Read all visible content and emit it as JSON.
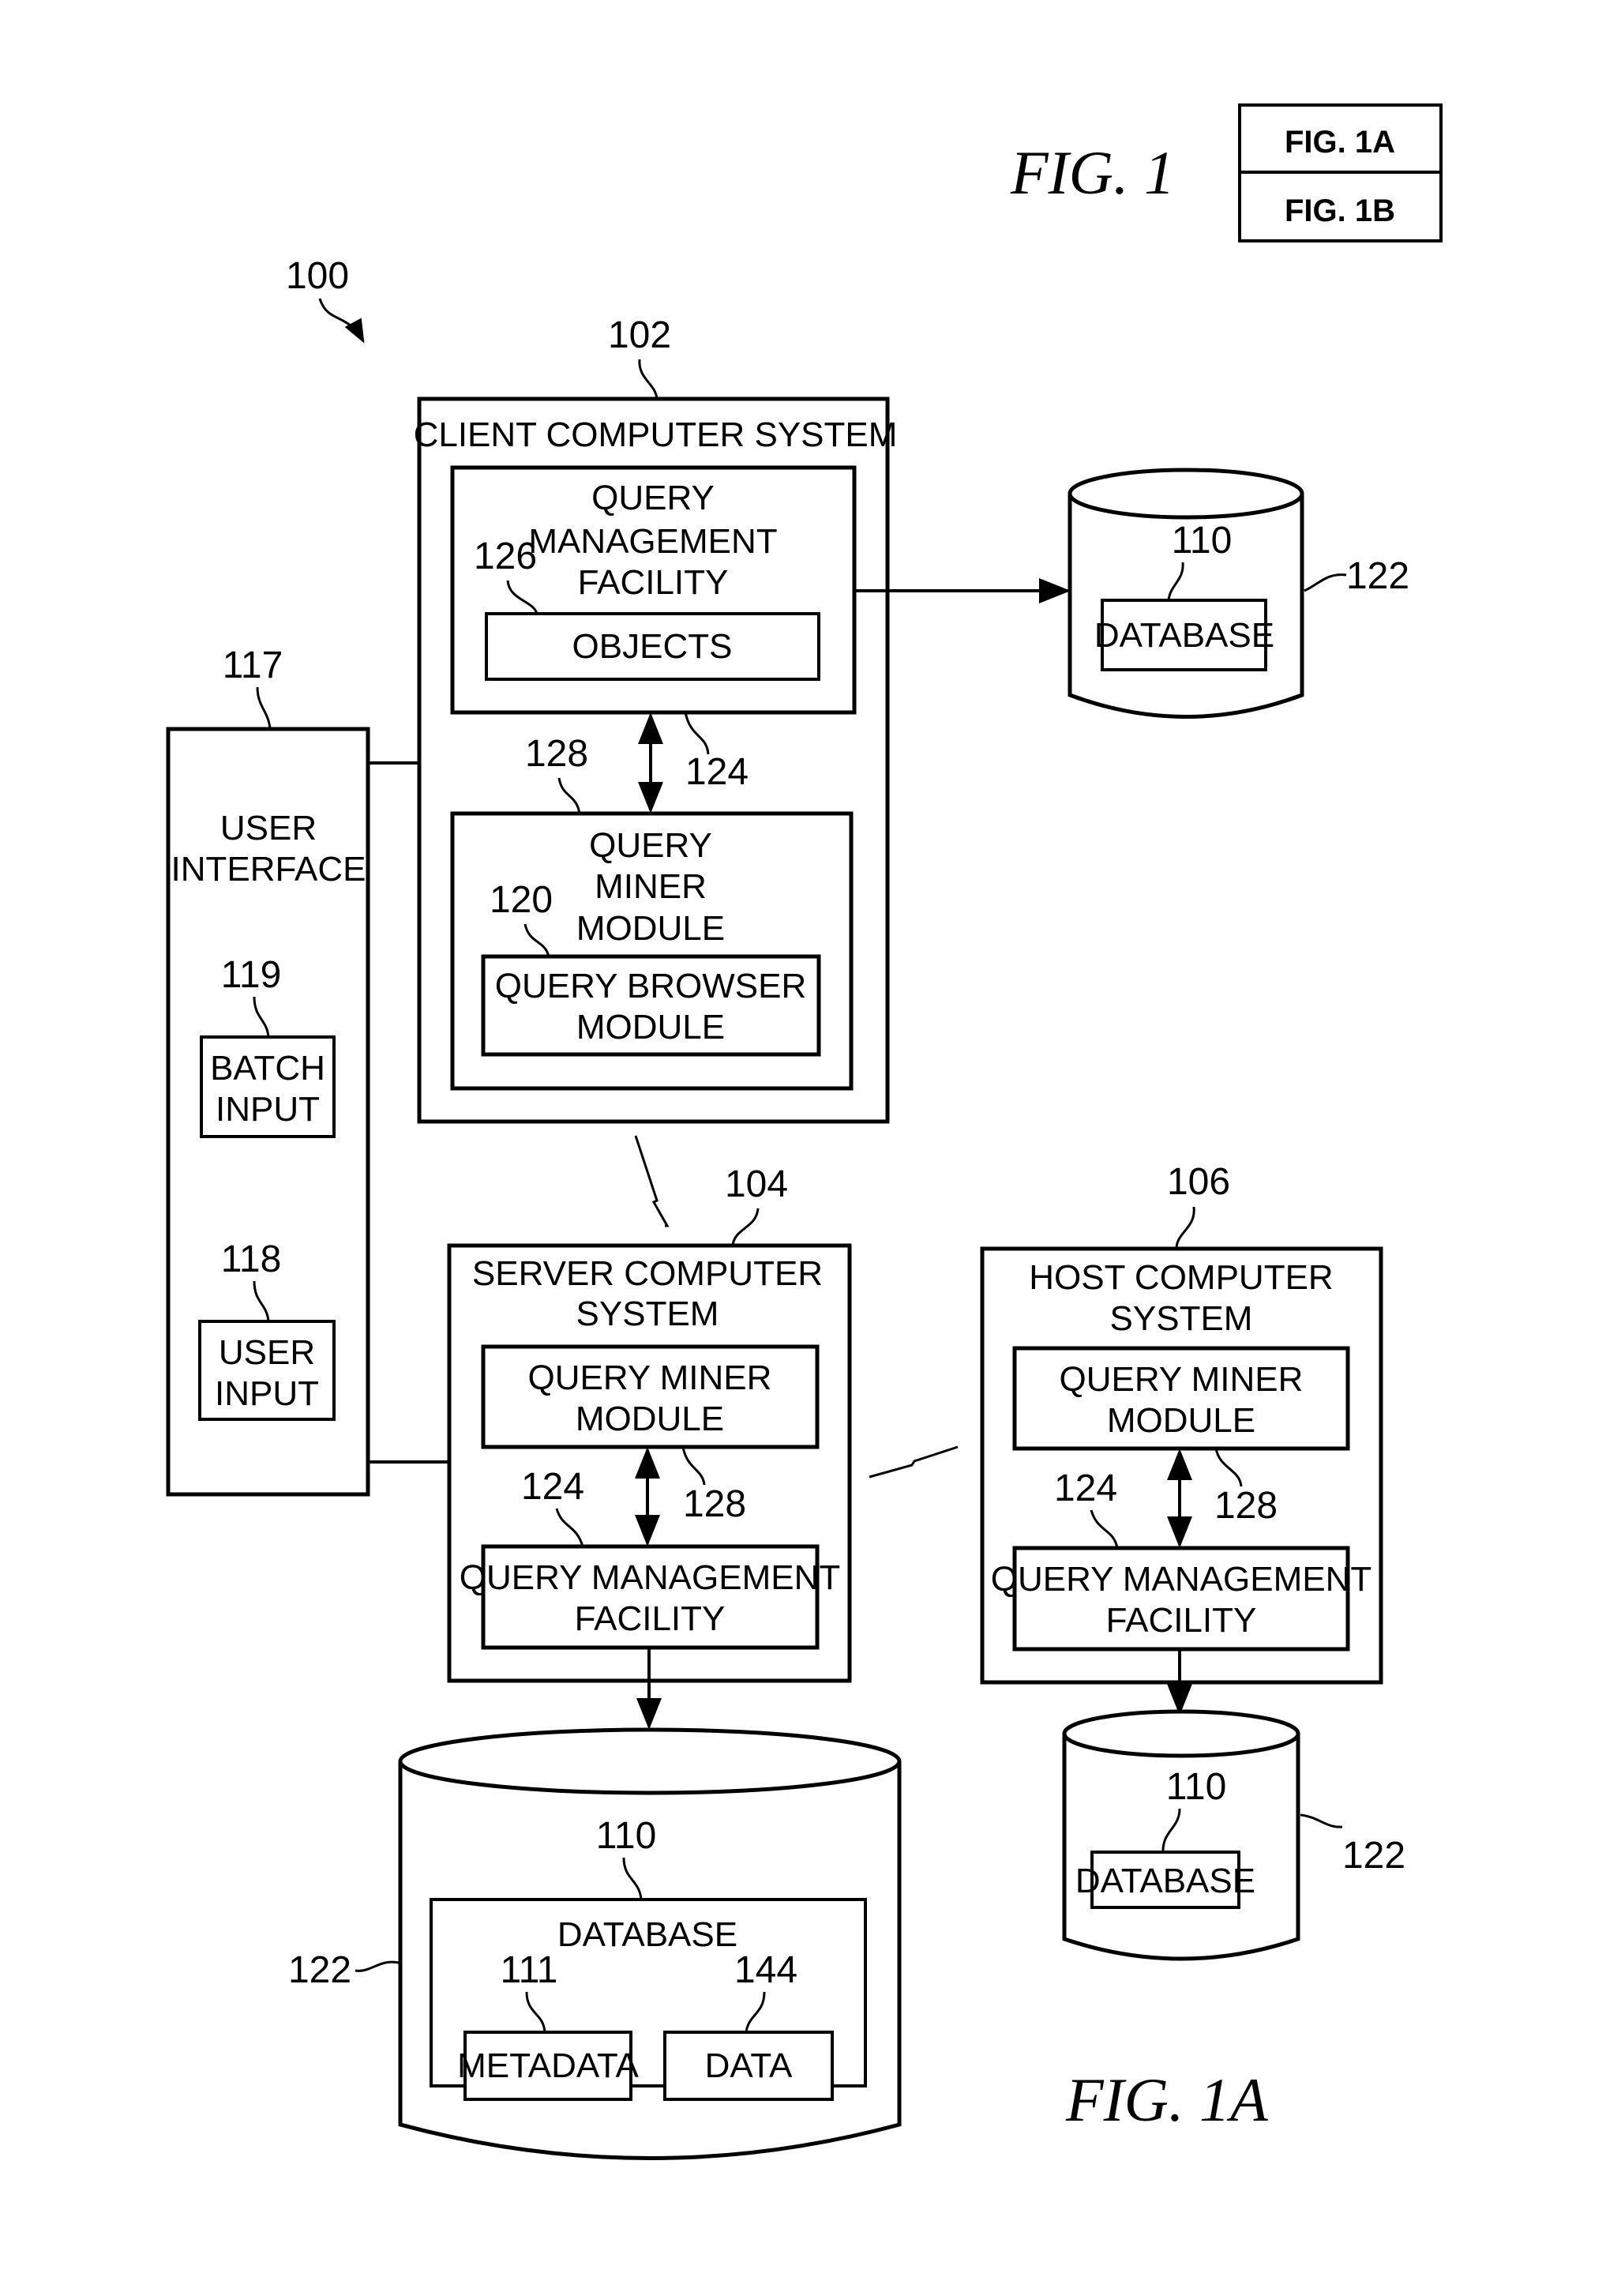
{
  "figure": {
    "title": "FIG. 1",
    "subfigure_caption": "FIG. 1A",
    "key_table": [
      "FIG. 1A",
      "FIG. 1B"
    ]
  },
  "refs": {
    "system": "100",
    "client": "102",
    "server": "104",
    "host": "106",
    "database": "110",
    "metadata": "111",
    "ui": "117",
    "user_input": "118",
    "batch_input": "119",
    "query_browser": "120",
    "storage": "122",
    "qmf": "124",
    "objects": "126",
    "qmm": "128",
    "data": "144"
  },
  "client": {
    "title": "CLIENT COMPUTER SYSTEM",
    "qmf_lines": [
      "QUERY",
      "MANAGEMENT",
      "FACILITY"
    ],
    "objects": "OBJECTS",
    "qmm_lines": [
      "QUERY",
      "MINER",
      "MODULE"
    ],
    "qbm_lines": [
      "QUERY BROWSER",
      "MODULE"
    ]
  },
  "ui": {
    "title_lines": [
      "USER",
      "INTERFACE"
    ],
    "batch_lines": [
      "BATCH",
      "INPUT"
    ],
    "user_input_lines": [
      "USER",
      "INPUT"
    ]
  },
  "server": {
    "title_lines": [
      "SERVER COMPUTER",
      "SYSTEM"
    ],
    "qmm_lines": [
      "QUERY MINER",
      "MODULE"
    ],
    "qmf_lines": [
      "QUERY MANAGEMENT",
      "FACILITY"
    ]
  },
  "host": {
    "title_lines": [
      "HOST COMPUTER",
      "SYSTEM"
    ],
    "qmm_lines": [
      "QUERY MINER",
      "MODULE"
    ],
    "qmf_lines": [
      "QUERY MANAGEMENT",
      "FACILITY"
    ]
  },
  "databases": {
    "client_db_label": "DATABASE",
    "host_db_label": "DATABASE",
    "server_db_label": "DATABASE",
    "metadata_label": "METADATA",
    "data_label": "DATA"
  }
}
